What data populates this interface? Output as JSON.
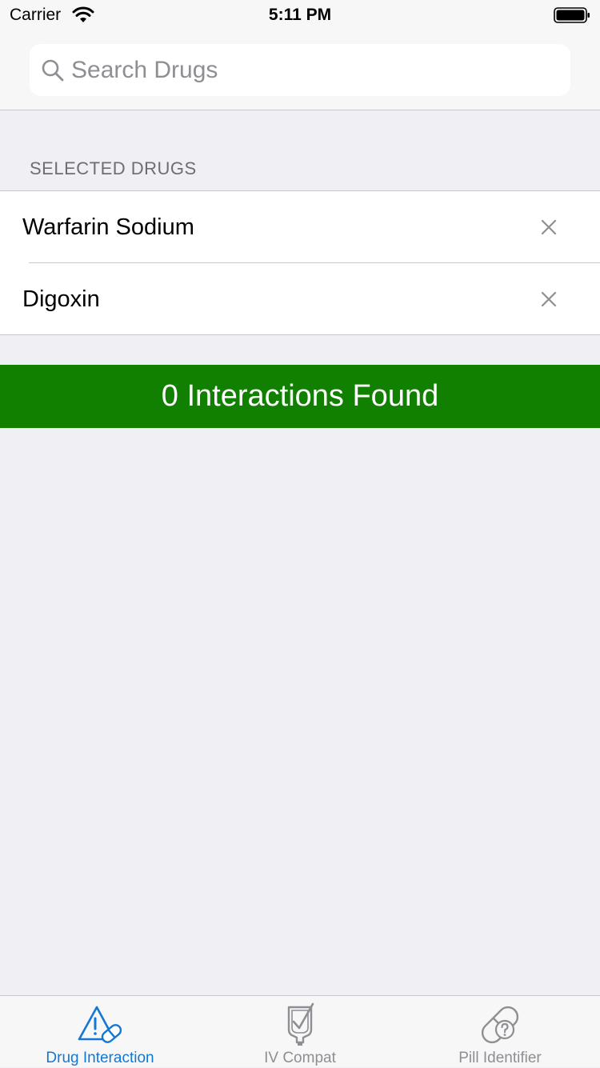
{
  "status_bar": {
    "carrier": "Carrier",
    "time": "5:11 PM"
  },
  "search": {
    "placeholder": "Search Drugs",
    "value": ""
  },
  "selected_section": {
    "header": "SELECTED DRUGS",
    "drugs": [
      {
        "name": "Warfarin Sodium"
      },
      {
        "name": "Digoxin"
      }
    ]
  },
  "result": {
    "text": "0 Interactions Found",
    "color": "#118001"
  },
  "tab_bar": {
    "active_color": "#1477d4",
    "inactive_color": "#8e8e93",
    "tabs": [
      {
        "label": "Drug Interaction",
        "icon": "warning-pill-icon",
        "active": true
      },
      {
        "label": "IV Compat",
        "icon": "iv-bag-check-icon",
        "active": false
      },
      {
        "label": "Pill Identifier",
        "icon": "pill-question-icon",
        "active": false
      }
    ]
  }
}
